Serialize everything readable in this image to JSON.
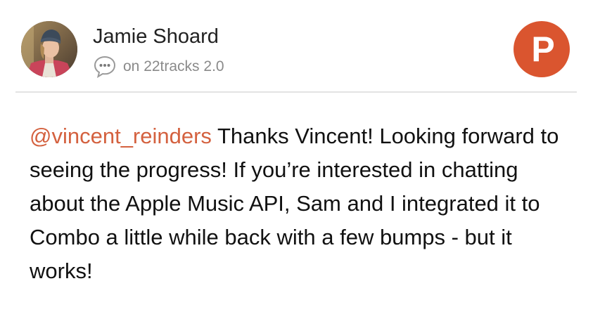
{
  "author": {
    "name": "Jamie Shoard"
  },
  "context": {
    "icon": "comment-bubble-icon",
    "text": "on 22tracks 2.0"
  },
  "badge": {
    "icon": "product-hunt-icon",
    "letter": "P",
    "color": "#da552f"
  },
  "comment": {
    "mention": "@vincent_reinders",
    "mention_color": "#d4613f",
    "body": " Thanks Vincent! Looking forward to seeing the progress! If you’re interested in chatting about the Apple Music API, Sam and I integrated it to Combo a little while back with a few bumps - but it works!"
  }
}
